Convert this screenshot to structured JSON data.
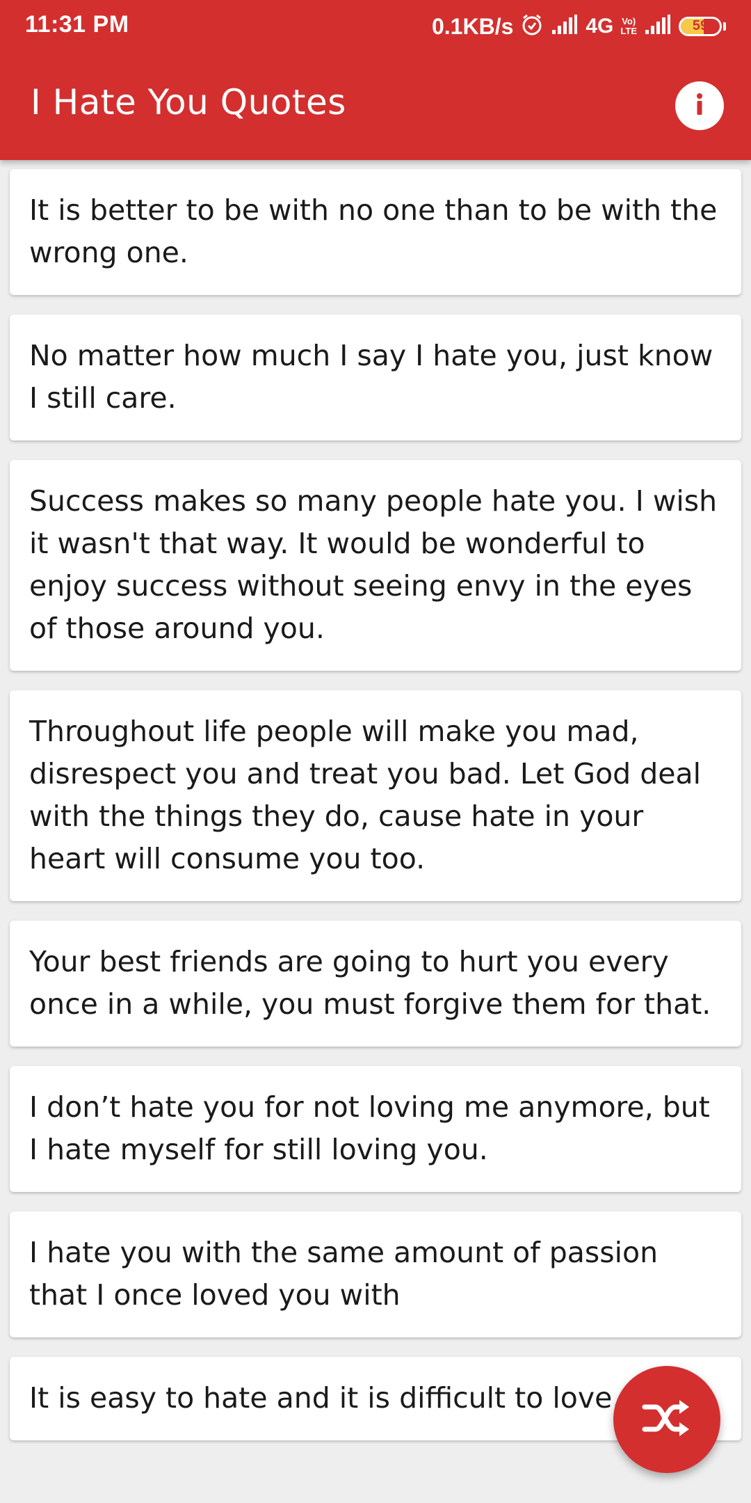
{
  "status_bar": {
    "time": "11:31 PM",
    "net_speed": "0.1KB/s",
    "network_type": "4G",
    "volte_line1": "Vo)",
    "volte_line2": "LTE",
    "battery_level": "59",
    "battery_fraction": 0.59
  },
  "app_bar": {
    "title": "I Hate You Quotes",
    "info_icon": "info-icon"
  },
  "quotes": [
    {
      "text": "It is better to be with no one than to be with the wrong one."
    },
    {
      "text": "No matter how much I say I hate you, just know I still care."
    },
    {
      "text": "Success makes so many people hate you. I wish it wasn't that way. It would be wonderful to enjoy success without seeing envy in the eyes of those around you."
    },
    {
      "text": "Throughout life people will make you mad, disrespect you and treat you bad. Let God deal with the things they do, cause hate in your heart will consume you too."
    },
    {
      "text": "Your best friends are going to hurt you every once in a while, you must forgive them for that."
    },
    {
      "text": "I don’t hate you for not loving me anymore, but I hate myself for still loving you."
    },
    {
      "text": "I hate you with the same amount of passion that I once loved you with"
    },
    {
      "text": "It is easy to hate and it is difficult to love. This"
    }
  ],
  "fab": {
    "icon": "shuffle-icon"
  },
  "colors": {
    "primary": "#d32f2f",
    "background": "#eeeeee",
    "card": "#ffffff",
    "text": "#1a1a1a"
  }
}
